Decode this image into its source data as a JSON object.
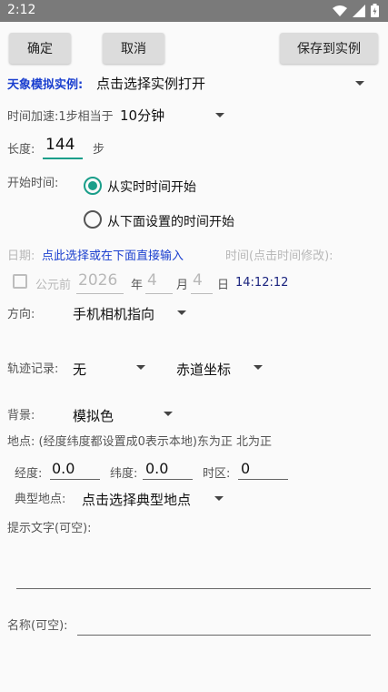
{
  "status": {
    "time": "2:12"
  },
  "buttons": {
    "ok": "确定",
    "cancel": "取消",
    "save": "保存到实例"
  },
  "example": {
    "label": "天象模拟实例:",
    "value": "点击选择实例打开"
  },
  "speed": {
    "label": "时间加速:1步相当于",
    "value": "10分钟"
  },
  "length": {
    "label": "长度:",
    "value": "144",
    "unit": "步"
  },
  "start": {
    "label": "开始时间:",
    "option_realtime": "从实时时间开始",
    "option_custom": "从下面设置的时间开始",
    "selected": "realtime"
  },
  "date": {
    "label": "日期:",
    "hint": "点此选择或在下面直接输入",
    "time_hint": "时间(点击时间修改):",
    "ad_label": "公元前",
    "year": "2026",
    "year_unit": "年",
    "month": "4",
    "month_unit": "月",
    "day": "4",
    "day_unit": "日",
    "clock": "14:12:12"
  },
  "direction": {
    "label": "方向:",
    "value": "手机相机指向"
  },
  "track": {
    "label": "轨迹记录:",
    "value": "无",
    "coord": "赤道坐标"
  },
  "background": {
    "label": "背景:",
    "value": "模拟色"
  },
  "location": {
    "label": "地点: (经度纬度都设置成0表示本地)东为正 北为正",
    "lon_label": "经度:",
    "lon": "0.0",
    "lat_label": "纬度:",
    "lat": "0.0",
    "tz_label": "时区:",
    "tz": "0",
    "typical_label": "典型地点:",
    "typical_value": "点击选择典型地点"
  },
  "hint_text": {
    "label": "提示文字(可空):",
    "value": ""
  },
  "name": {
    "label": "名称(可空):",
    "value": ""
  }
}
